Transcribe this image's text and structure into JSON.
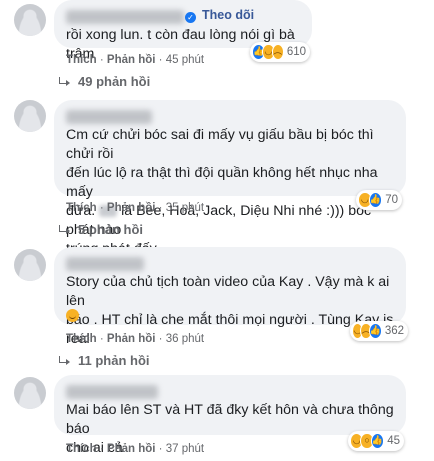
{
  "comments": [
    {
      "follow_label": "Theo dõi",
      "text": "rồi xong lun. t còn đau lòng nói gì bà trâm",
      "reaction_count": "610",
      "reactions": [
        "like",
        "haha",
        "sad"
      ],
      "like_label": "Thích",
      "reply_label": "Phản hồi",
      "time": "45 phút",
      "replies_label": "49 phản hồi"
    },
    {
      "text_part1": "Cm cứ chửi bóc sai đi mấy vụ giấu bầu bị bóc thì chửi rồi\nđến lúc lộ ra thật thì đội quần không hết nhục nha mấy\nđứa. ",
      "text_part2": " là Bee, Hoà, Jack, Diệu Nhi nhé :))) bóc phát nào\ntrúng phát đấy",
      "reaction_count": "70",
      "reactions": [
        "haha",
        "like"
      ],
      "like_label": "Thích",
      "reply_label": "Phản hồi",
      "time": "35 phút",
      "replies_label": "5 phản hồi"
    },
    {
      "text": "Story của chủ tịch toàn video của Kay . Vậy mà k ai lên\nbáo . HT chỉ là che mắt thôi mọi người . Tùng Kay is real",
      "reaction_count": "362",
      "reactions": [
        "haha",
        "sad",
        "like"
      ],
      "like_label": "Thích",
      "reply_label": "Phản hồi",
      "time": "36 phút",
      "replies_label": "11 phản hồi"
    },
    {
      "text": "Mai báo lên ST và HT đã đky kết hôn và chưa thông báo\ncho ai cả",
      "reaction_count": "45",
      "reactions": [
        "haha",
        "wow",
        "like"
      ],
      "like_label": "Thích",
      "reply_label": "Phản hồi",
      "time": "37 phút"
    }
  ],
  "separator": "·"
}
